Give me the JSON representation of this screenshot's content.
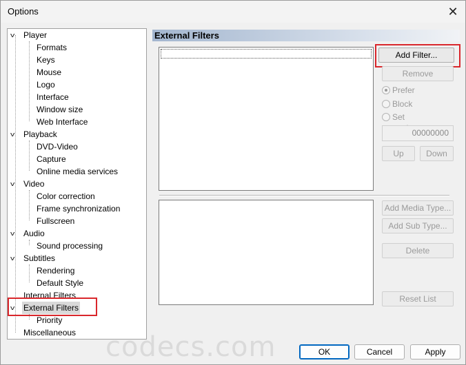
{
  "window": {
    "title": "Options"
  },
  "tree": {
    "groups": [
      {
        "label": "Player",
        "children": [
          "Formats",
          "Keys",
          "Mouse",
          "Logo",
          "Interface",
          "Window size",
          "Web Interface"
        ]
      },
      {
        "label": "Playback",
        "children": [
          "DVD-Video",
          "Capture",
          "Online media services"
        ]
      },
      {
        "label": "Video",
        "children": [
          "Color correction",
          "Frame synchronization",
          "Fullscreen"
        ]
      },
      {
        "label": "Audio",
        "children": [
          "Sound processing"
        ]
      },
      {
        "label": "Subtitles",
        "children": [
          "Rendering",
          "Default Style"
        ]
      },
      {
        "label": "Internal Filters"
      },
      {
        "label": "External Filters",
        "children": [
          "Priority"
        ]
      },
      {
        "label": "Miscellaneous"
      }
    ],
    "selected": "External Filters"
  },
  "panel": {
    "header": "External Filters",
    "add_filter": "Add Filter...",
    "remove": "Remove",
    "prefer": "Prefer",
    "block": "Block",
    "set_merit": "Set merit:",
    "merit_value": "00000000",
    "up": "Up",
    "down": "Down",
    "add_media_type": "Add Media Type...",
    "add_sub_type": "Add Sub Type...",
    "delete": "Delete",
    "reset_list": "Reset List"
  },
  "footer": {
    "ok": "OK",
    "cancel": "Cancel",
    "apply": "Apply"
  },
  "watermark": "codecs.com",
  "colors": {
    "highlight": "#d9262b",
    "default_button": "#0067c0"
  }
}
